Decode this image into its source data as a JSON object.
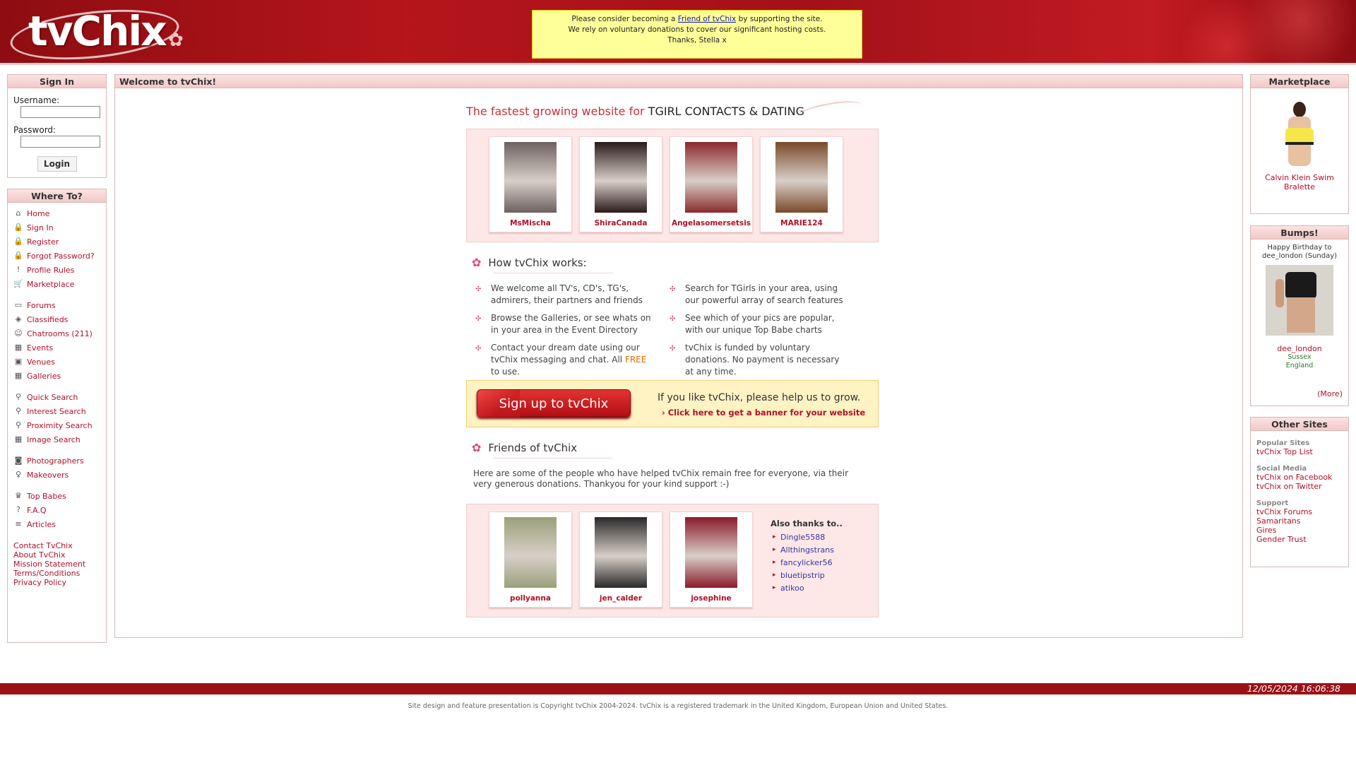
{
  "header": {
    "logo_text": "tvChix",
    "donate": {
      "pre": "Please consider becoming a ",
      "link": "Friend of tvChix",
      "post": " by supporting the site.",
      "line2": "We rely on voluntary donations to cover our significant hosting costs.",
      "line3": "Thanks, Stella x"
    }
  },
  "signin": {
    "title": "Sign In",
    "username_label": "Username:",
    "password_label": "Password:",
    "username_value": "",
    "password_value": "",
    "login_button": "Login"
  },
  "whereto": {
    "title": "Where To?",
    "items": [
      {
        "label": "Home",
        "icon": "home-icon",
        "glyph": "⌂"
      },
      {
        "label": "Sign In",
        "icon": "lock-icon",
        "glyph": "🔒"
      },
      {
        "label": "Register",
        "icon": "lock-icon",
        "glyph": "🔒"
      },
      {
        "label": "Forgot Password?",
        "icon": "lock-icon",
        "glyph": "🔒"
      },
      {
        "label": "Profile Rules",
        "icon": "warning-icon",
        "glyph": "!"
      },
      {
        "label": "Marketplace",
        "icon": "cart-icon",
        "glyph": "🛒"
      },
      {
        "label": "Forums",
        "icon": "forum-icon",
        "glyph": "▭"
      },
      {
        "label": "Classifieds",
        "icon": "tag-icon",
        "glyph": "◈"
      },
      {
        "label": "Chatrooms (211)",
        "icon": "user-icon",
        "glyph": "☺"
      },
      {
        "label": "Events",
        "icon": "calendar-icon",
        "glyph": "▦"
      },
      {
        "label": "Venues",
        "icon": "venue-icon",
        "glyph": "▣"
      },
      {
        "label": "Galleries",
        "icon": "gallery-icon",
        "glyph": "▦"
      },
      {
        "label": "Quick Search",
        "icon": "search-icon",
        "glyph": "⚲"
      },
      {
        "label": "Interest Search",
        "icon": "search-icon",
        "glyph": "⚲"
      },
      {
        "label": "Proximity Search",
        "icon": "search-icon",
        "glyph": "⚲"
      },
      {
        "label": "Image Search",
        "icon": "image-search-icon",
        "glyph": "▦"
      },
      {
        "label": "Photographers",
        "icon": "camera-icon",
        "glyph": "◙"
      },
      {
        "label": "Makeovers",
        "icon": "makeover-icon",
        "glyph": "♀"
      },
      {
        "label": "Top Babes",
        "icon": "trophy-icon",
        "glyph": "♛"
      },
      {
        "label": "F.A.Q",
        "icon": "faq-icon",
        "glyph": "?"
      },
      {
        "label": "Articles",
        "icon": "article-icon",
        "glyph": "≡"
      }
    ],
    "footer_links": [
      "Contact TvChix",
      "About TvChix",
      "Mission Statement",
      "Terms/Conditions",
      "Privacy Policy"
    ]
  },
  "welcome": {
    "title": "Welcome to tvChix!",
    "tagline_red": "The fastest growing website for ",
    "tagline_dark": "TGIRL CONTACTS & DATING",
    "profiles": [
      {
        "name": "MsMischa",
        "color": "#6d6060"
      },
      {
        "name": "ShiraCanada",
        "color": "#2a1a1a"
      },
      {
        "name": "Angelasomersetsis",
        "color": "#8a2a2a"
      },
      {
        "name": "MARIE124",
        "color": "#7a4a2a"
      }
    ],
    "how_title": "How tvChix works:",
    "how_items": [
      {
        "text": "We welcome all TV's, CD's, TG's, admirers, their partners and friends"
      },
      {
        "text": "Search for TGirls in your area, using our powerful array of search features"
      },
      {
        "text": "Browse the Galleries, or see whats on in your area in the Event Directory"
      },
      {
        "text": "See which of your pics are popular, with our unique Top Babe charts"
      },
      {
        "text": "Contact your dream date using our tvChix messaging and chat. All ",
        "free": "FREE",
        "tail": " to use."
      },
      {
        "text": "tvChix is funded by voluntary donations. No payment is necessary at any time."
      }
    ],
    "signup_button": "Sign up to tvChix",
    "grow_text": "If you like tvChix, please help us to grow.",
    "banner_link": "› Click here to get a banner for your website",
    "friends_title": "Friends of tvChix",
    "friends_desc": "Here are some of the people who have helped tvChix remain free for everyone, via their very generous donations. Thankyou for your kind support :-)",
    "friends": [
      {
        "name": "pollyanna",
        "color": "#9aa07a"
      },
      {
        "name": "jen_calder",
        "color": "#2a2a2a"
      },
      {
        "name": "josephine",
        "color": "#8a1a2a"
      }
    ],
    "also_thanks_title": "Also thanks to..",
    "also_thanks": [
      "Dingle5588",
      "Allthingstrans",
      "fancylicker56",
      "bluetipstrip",
      "atikoo"
    ]
  },
  "marketplace": {
    "title": "Marketplace",
    "item_label": "Calvin Klein Swim Bralette"
  },
  "bumps": {
    "title": "Bumps!",
    "message": "Happy Birthday to dee_london (Sunday)",
    "user": "dee_london",
    "county": "Sussex",
    "country": "England",
    "more": "(More)"
  },
  "othersites": {
    "title": "Other Sites",
    "groups": [
      {
        "header": "Popular Sites",
        "links": [
          "tvChix Top List"
        ]
      },
      {
        "header": "Social Media",
        "links": [
          "tvChix on Facebook",
          "tvChix on Twitter"
        ]
      },
      {
        "header": "Support",
        "links": [
          "tvChix Forums",
          "Samaritans",
          "Gires",
          "Gender Trust"
        ]
      }
    ]
  },
  "footer": {
    "timestamp": "12/05/2024 16:06:38",
    "copyright": "Site design and feature presentation is Copyright tvChix 2004-2024. tvChix is a registered trademark in the United Kingdom, European Union and United States."
  },
  "colors": {
    "brand_red": "#b5151b",
    "link": "#b0102a",
    "donate_bg": "#ffff99"
  }
}
